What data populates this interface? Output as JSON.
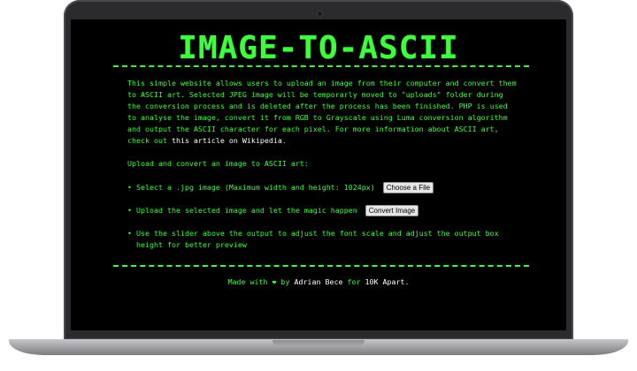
{
  "app": {
    "title": "IMAGE-TO-ASCII",
    "intro_before_link": "This simple website allows users to upload an image from their computer and convert them to ASCII art. Selected JPEG image will be temporarly moved to \"uploads\" folder during the conversion process and is deleted after the process has been finished. PHP is used to analyse the image, convert it from RGB to Grayscale using Luma conversion algorithm and output the ASCII character for each pixel. For more information about ASCII art, check out ",
    "intro_link": "this article on Wikipedia",
    "intro_after_link": ".",
    "upload_heading": "Upload and convert an image to ASCII art:",
    "steps": [
      {
        "text": "Select a .jpg image (Maximum width and height: 1024px)",
        "button": "Choose a File"
      },
      {
        "text": "Upload the selected image and let the magic happen",
        "button": "Convert Image"
      },
      {
        "text": "Use the slider above the output to adjust the font scale and adjust the output box height for better preview"
      }
    ],
    "footer": {
      "made_with": "Made with",
      "heart_icon": "heart-icon",
      "by": "by",
      "author": "Adrian Bece",
      "for": "for",
      "event": "10K Apart."
    }
  },
  "colors": {
    "accent": "#3dff3d",
    "background": "#000000",
    "link": "#ffffff"
  }
}
